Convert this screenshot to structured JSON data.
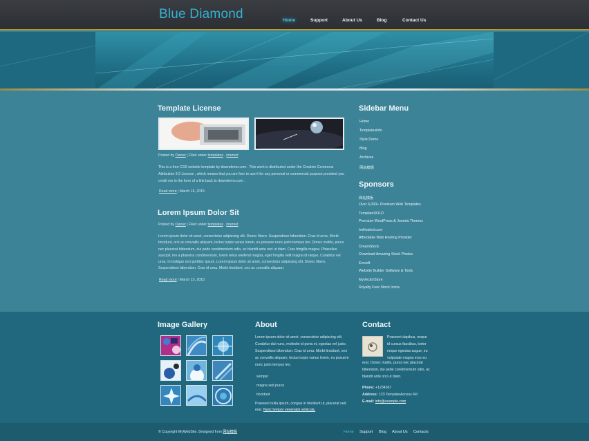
{
  "site": {
    "title": "Blue Diamond"
  },
  "nav": [
    "Home",
    "Support",
    "About Us",
    "Blog",
    "Contact Us"
  ],
  "posts": [
    {
      "title": "Template License",
      "meta_prefix": "Posted by",
      "author": "Owner",
      "filed_under": "Filed under",
      "tags": [
        "templates",
        "internet"
      ],
      "body_lines": [
        "This is a free CSS website template by downdemo.com . This work is distributed under the Creative Commons",
        "Attribution 3.0 License , which means that you are free to use it for any personal or commercial purpose provided you",
        "credit me in the form of a link back to downdemo.com ."
      ],
      "read_more": "Read more",
      "date": "March 16, 2015"
    },
    {
      "title": "Lorem Ipsum Dolor Sit",
      "meta_prefix": "Posted by",
      "author": "Owner",
      "filed_under": "Filed under",
      "tags": [
        "templates",
        "internet"
      ],
      "body_lines": [
        "Lorem ipsum dolor sit amet, consectetur adipiscing elit. Donec libero. Suspendisse bibendum. Cras id urna. Morbi",
        "tincidunt, orci ac convallis aliquam, lectus turpis varius lorem, eu posuere nunc justo tempus leo. Donec mattis, purus",
        "nec placerat bibendum, dui pede condimentum odio, ac blandit ante orci ut diam. Cras fringilla magna. Phasellus",
        "suscipit, leo a pharetra condimentum, lorem tellus eleifend magna, eget fringilla velit magna id neque. Curabitur vel",
        "urna. In tristique orci porttitor ipsum. Lorem ipsum dolor sit amet, consectetur adipiscing elit. Donec libero.",
        "Suspendisse bibendum. Cras id urna. Morbi tincidunt, orci ac convallis aliquam."
      ],
      "read_more": "Read more",
      "date": "March 15, 2015"
    }
  ],
  "sidebar": {
    "menu_title": "Sidebar Menu",
    "menu": [
      "Home",
      "Templatesinfo",
      "Style Demo",
      "Blog",
      "Archives",
      "网站模板"
    ],
    "sponsors_title": "Sponsors",
    "sponsors": [
      {
        "name": "网站模板",
        "desc": "Over 6,000+ Premium Web Templates"
      },
      {
        "name": "TemplateSOLD",
        "desc": "Premium WordPress & Joomla Themes"
      },
      {
        "name": "ImHosted.com",
        "desc": "Affordable Web Hosting Provider"
      },
      {
        "name": "DreamStock",
        "desc": "Download Amazing Stock Photos"
      },
      {
        "name": "Evrsoft",
        "desc": "Website Builder Software & Tools"
      },
      {
        "name": "MyVectorStore",
        "desc": "Royalty Free Stock Icons"
      }
    ]
  },
  "gallery": {
    "title": "Image Gallery"
  },
  "about": {
    "title": "About",
    "lines": [
      "Lorem ipsum dolor sit amet, consectetur adipiscing elit.",
      "Curabitur dui nunc, molestie id porta et, egestas vel justo.",
      "Suspendisse bibendum. Cras id urna. Morbi tincidunt, orci",
      "ac convallis aliquam, lectus turpis varius lorem, eu posuere",
      "nunc justo tempus leo."
    ],
    "items": [
      "semper",
      "magna sed purus",
      "tincidunt"
    ],
    "closing": [
      "Praesent nulla ipsum, congue in tincidunt ut, placerat sed",
      "erat.",
      "Nunc tempor venenatis vehicula."
    ]
  },
  "contact": {
    "title": "Contact",
    "text_lines": [
      "Praesent dapibus, neque",
      "id cursus faucibus, tortor",
      "neque egestas augue, eu",
      "vulputate magna eros eu",
      "erat. Donec mattis, purus nec placerat",
      "bibendum, dui pede condimentum odio, ac",
      "blandit ante orci ut diam."
    ],
    "phone_label": "Phone:",
    "phone": "+1234567",
    "address_label": "Address:",
    "address": "123 TemplateAccess Rd",
    "email_label": "E-mail:",
    "email": "info@example.com"
  },
  "footer": {
    "copyright": "© Copyright MyWebSite. Designed from",
    "designer": "网站模板",
    "nav": [
      "Home",
      "Support",
      "Blog",
      "About Us",
      "Contacts"
    ]
  },
  "colors": {
    "accent": "#35b3d6",
    "header": "#2e3135",
    "content": "#3c8398",
    "footer": "#21687e"
  }
}
